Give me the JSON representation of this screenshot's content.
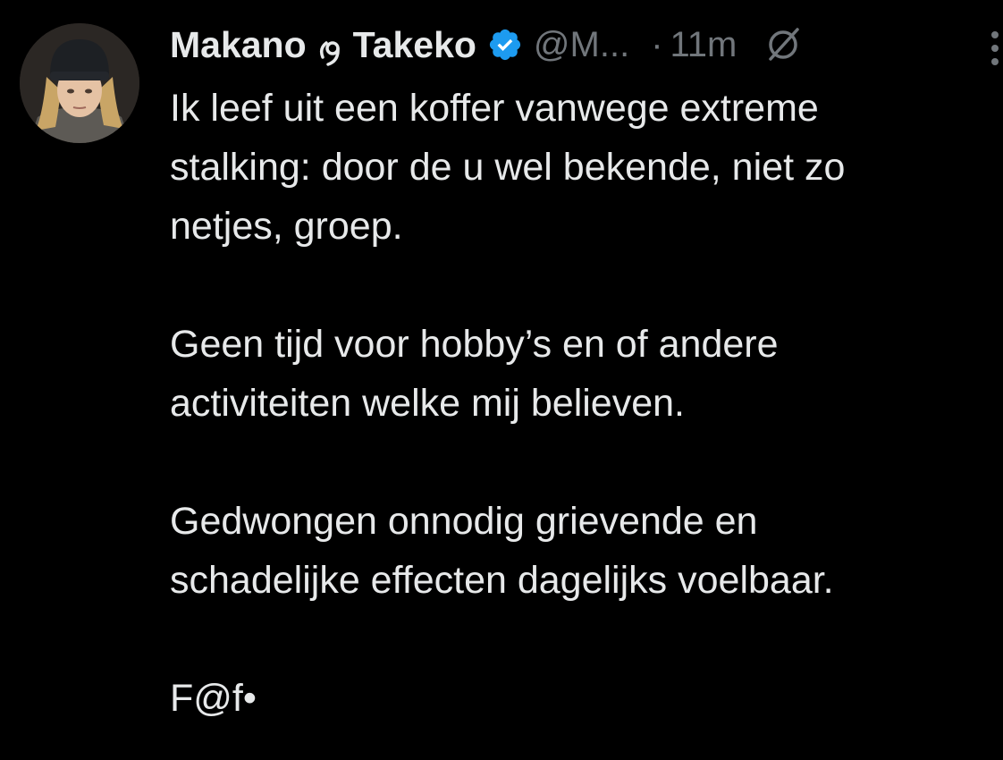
{
  "tweet": {
    "author": {
      "name_first": "Makano",
      "name_last": "Takeko",
      "handle": "@M...",
      "verified": true,
      "avatar_icon": "user-avatar-photo"
    },
    "separator": "·",
    "timestamp": "11m",
    "paragraphs": [
      "Ik leef uit een koffer vanwege extreme\nstalking: door de u wel bekende, niet zo\nnetjes, groep.",
      "Geen tijd voor hobby’s en of andere\nactiviteiten welke mij believen.",
      "Gedwongen onnodig grievende en\nschadelijke effecten dagelijks voelbaar.",
      "F@f•"
    ],
    "icons": {
      "verified": "verified-badge-icon",
      "grok": "grok-icon",
      "more": "more-options-icon"
    },
    "colors": {
      "background": "#000000",
      "text": "#e7e9ea",
      "secondary": "#71767b",
      "verified": "#1d9bf0"
    }
  }
}
